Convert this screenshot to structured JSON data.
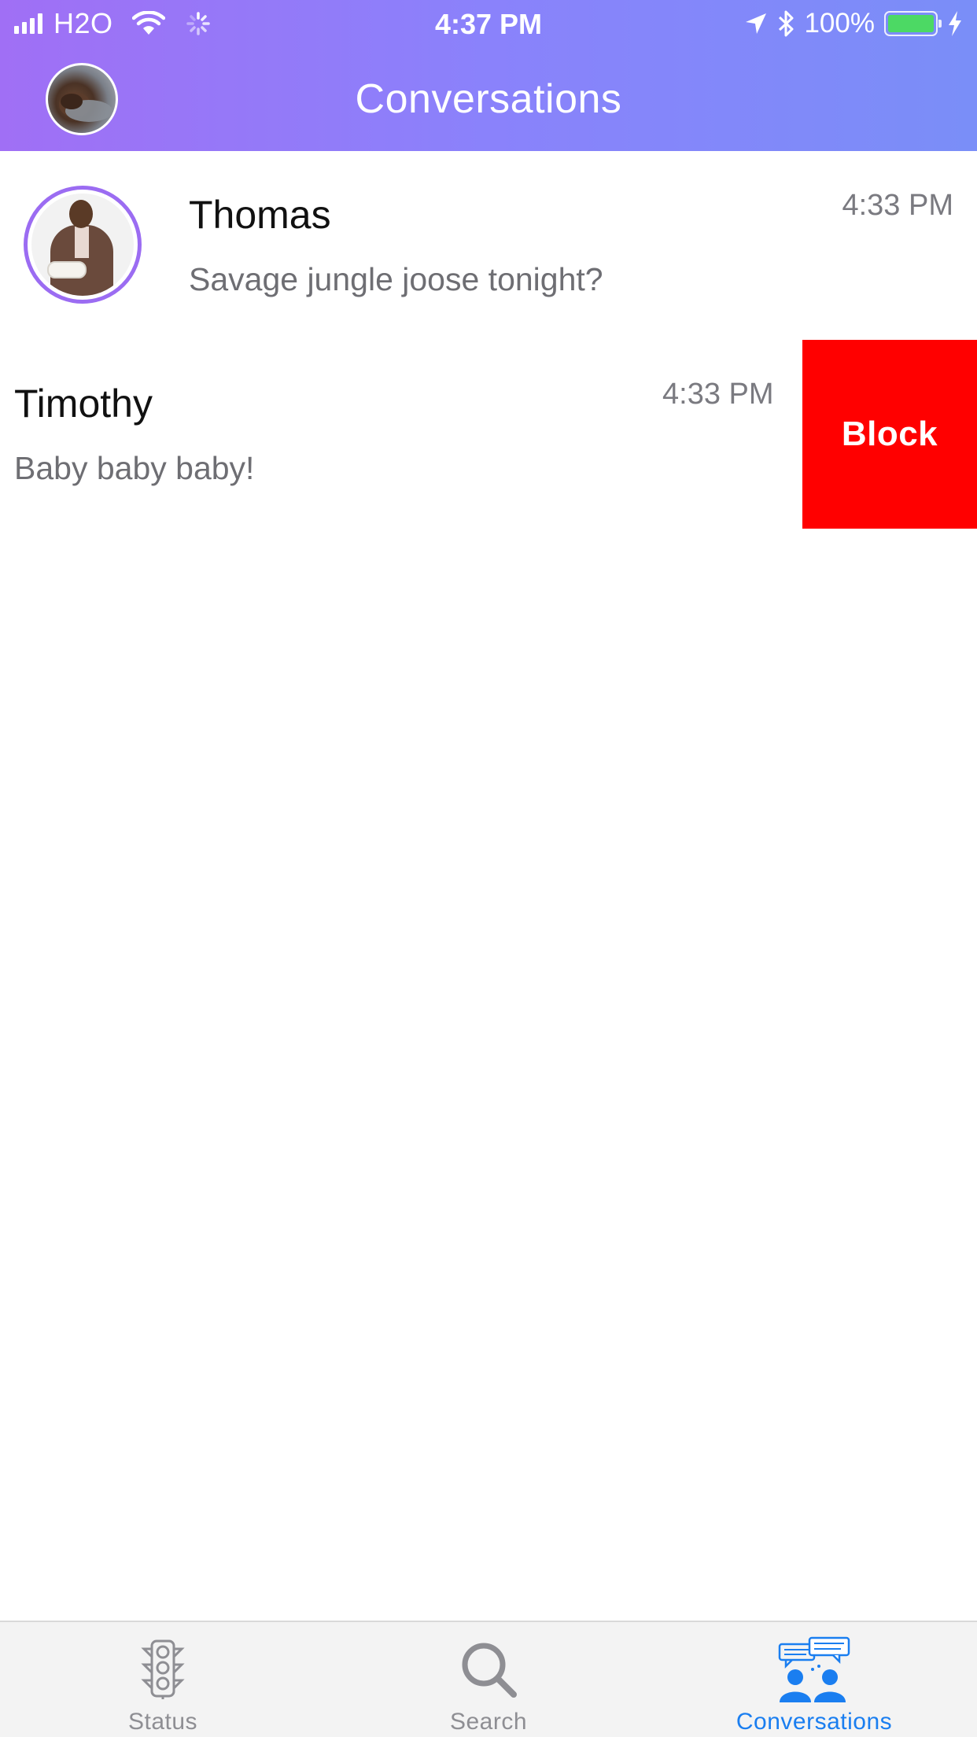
{
  "status_bar": {
    "carrier": "H2O",
    "time": "4:37 PM",
    "battery_percent": "100%",
    "battery_level": 1.0,
    "icons": [
      "signal-icon",
      "wifi-icon",
      "activity-spinner-icon",
      "location-arrow-icon",
      "bluetooth-icon",
      "battery-icon",
      "charging-bolt-icon"
    ]
  },
  "header": {
    "title": "Conversations",
    "accent_gradient": [
      "#a06ff5",
      "#7a8ef8"
    ]
  },
  "conversations": [
    {
      "name": "Thomas",
      "preview": "Savage jungle joose tonight?",
      "time": "4:33 PM",
      "has_avatar": true,
      "ring_color": "#9b6cf2"
    },
    {
      "name": "Timothy",
      "preview": "Baby baby baby!",
      "time": "4:33 PM",
      "swipe_action": "Block",
      "swipe_action_color": "#ff0000"
    }
  ],
  "tabbar": {
    "tabs": [
      {
        "label": "Status",
        "icon": "traffic-light-icon",
        "active": false
      },
      {
        "label": "Search",
        "icon": "search-icon",
        "active": false
      },
      {
        "label": "Conversations",
        "icon": "conversations-icon",
        "active": true
      }
    ],
    "active_color": "#1a7ef0",
    "inactive_color": "#8e8e93"
  }
}
